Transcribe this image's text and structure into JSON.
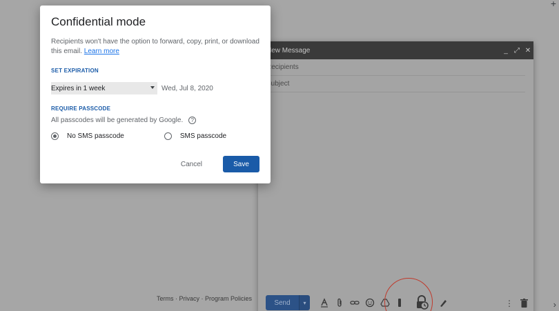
{
  "background": {
    "footer_links": "Terms · Privacy · Program Policies"
  },
  "compose": {
    "title": "New Message",
    "recipients_placeholder": "Recipients",
    "subject_placeholder": "Subject",
    "send_label": "Send"
  },
  "dialog": {
    "title": "Confidential mode",
    "description": "Recipients won't have the option to forward, copy, print, or download this email.",
    "learn_more": "Learn more",
    "expiration_heading": "SET EXPIRATION",
    "expiration_selected": "Expires in 1 week",
    "expiration_date": "Wed, Jul 8, 2020",
    "passcode_heading": "REQUIRE PASSCODE",
    "passcode_note": "All passcodes will be generated by Google.",
    "option_no_sms": "No SMS passcode",
    "option_sms": "SMS passcode",
    "cancel_label": "Cancel",
    "save_label": "Save"
  },
  "colors": {
    "accent": "#1a5ba8",
    "link": "#1a73e8",
    "highlight_circle": "#c0392b"
  }
}
